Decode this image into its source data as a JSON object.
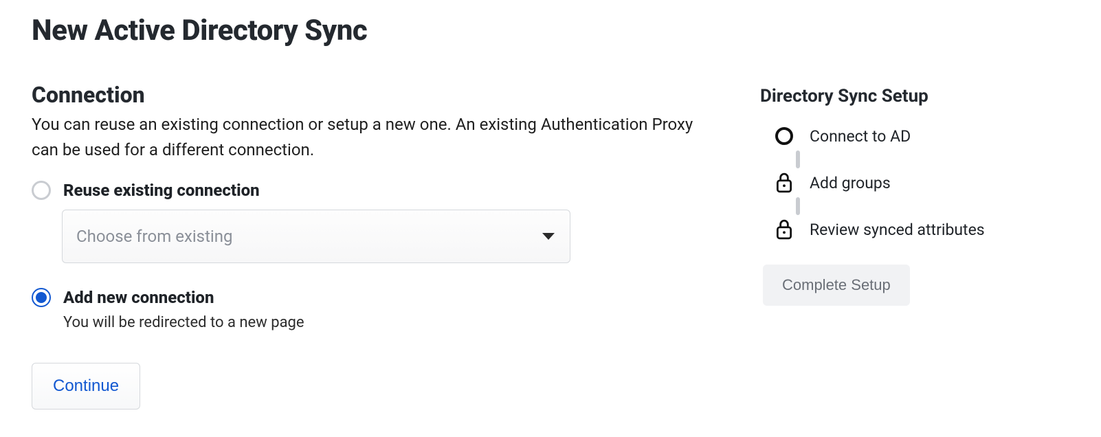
{
  "page": {
    "title": "New Active Directory Sync"
  },
  "connection": {
    "heading": "Connection",
    "description": "You can reuse an existing connection or setup a new one. An existing Authentication Proxy can be used for a different connection.",
    "reuse": {
      "label": "Reuse existing connection",
      "selected": false,
      "dropdown_placeholder": "Choose from existing"
    },
    "add_new": {
      "label": "Add new connection",
      "selected": true,
      "hint": "You will be redirected to a new page"
    },
    "continue_label": "Continue"
  },
  "setup": {
    "title": "Directory Sync Setup",
    "steps": [
      {
        "label": "Connect to AD",
        "state": "current"
      },
      {
        "label": "Add groups",
        "state": "locked"
      },
      {
        "label": "Review synced attributes",
        "state": "locked"
      }
    ],
    "complete_label": "Complete Setup"
  }
}
